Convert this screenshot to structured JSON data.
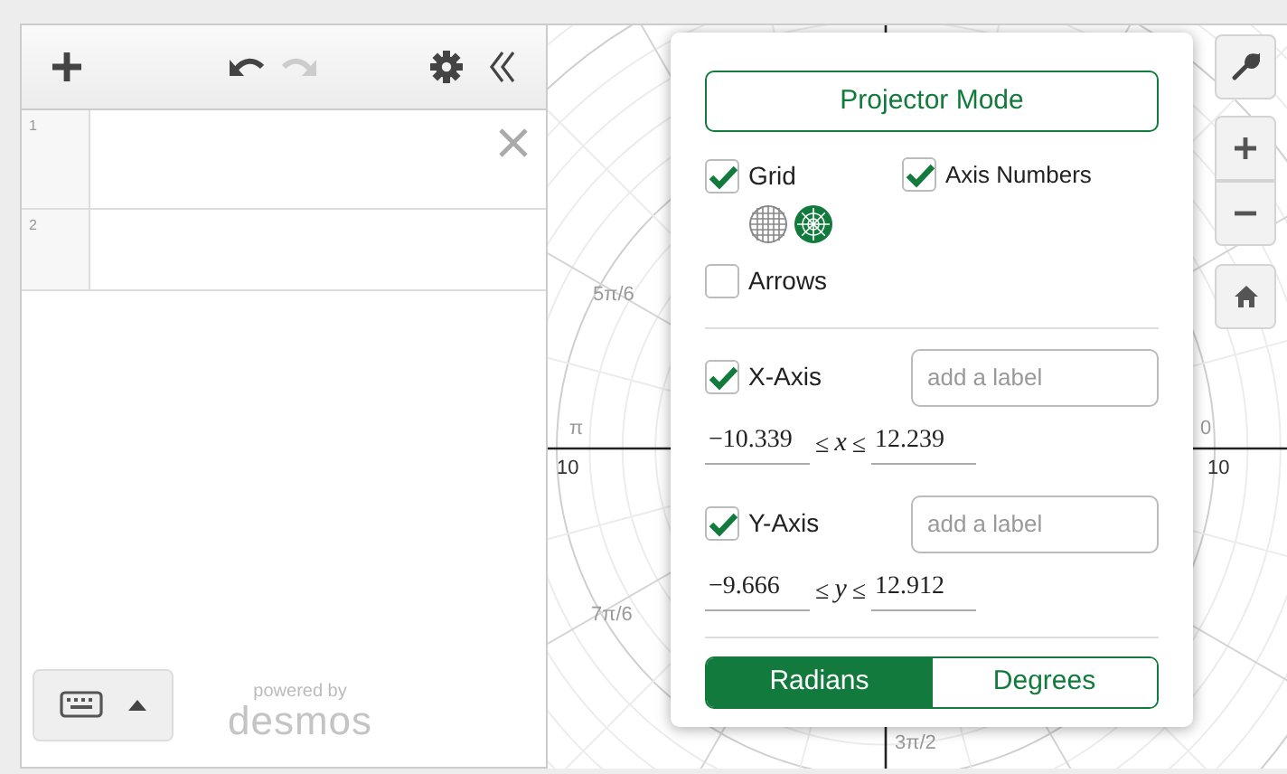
{
  "toolbar": {
    "undo_disabled": false,
    "redo_disabled": true
  },
  "expressions": [
    {
      "number": "1",
      "selected": true
    },
    {
      "number": "2",
      "selected": false
    }
  ],
  "footer": {
    "powered_by": "powered by",
    "brand": "desmos"
  },
  "graph": {
    "labels": [
      {
        "text": "5π/6",
        "kind": "angle"
      },
      {
        "text": "π",
        "kind": "angle"
      },
      {
        "text": "10",
        "kind": "number"
      },
      {
        "text": "0",
        "kind": "angle"
      },
      {
        "text": "10",
        "kind": "number"
      },
      {
        "text": "7π/6",
        "kind": "angle"
      },
      {
        "text": "3π/2",
        "kind": "angle"
      }
    ]
  },
  "settings": {
    "projector_mode": "Projector Mode",
    "grid": {
      "label": "Grid",
      "checked": true
    },
    "axis_numbers": {
      "label": "Axis Numbers",
      "checked": true
    },
    "grid_types": [
      {
        "kind": "cartesian",
        "selected": false
      },
      {
        "kind": "polar",
        "selected": true
      }
    ],
    "arrows": {
      "label": "Arrows",
      "checked": false
    },
    "axes": [
      {
        "label": "X-Axis",
        "checked": true,
        "placeholder": "add a label",
        "min": "−10.339",
        "op_1": "≤",
        "variable": "x",
        "op_2": "≤",
        "max": "12.239"
      },
      {
        "label": "Y-Axis",
        "checked": true,
        "placeholder": "add a label",
        "min": "−9.666",
        "op_1": "≤",
        "variable": "y",
        "op_2": "≤",
        "max": "12.912"
      }
    ],
    "units": [
      {
        "label": "Radians",
        "selected": true
      },
      {
        "label": "Degrees",
        "selected": false
      }
    ]
  }
}
